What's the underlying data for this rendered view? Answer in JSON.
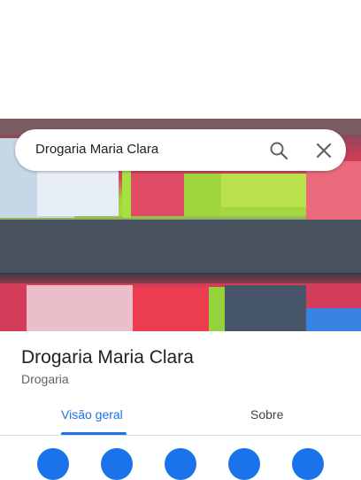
{
  "search": {
    "query": "Drogaria Maria Clara"
  },
  "place": {
    "title": "Drogaria Maria Clara",
    "category": "Drogaria"
  },
  "tabs": [
    {
      "label": "Visão geral",
      "active": true
    },
    {
      "label": "Sobre",
      "active": false
    }
  ],
  "colors": {
    "accent": "#1a73e8",
    "text_primary": "#202124",
    "text_secondary": "#5f6368"
  },
  "icons": [
    "search-icon",
    "close-icon"
  ]
}
